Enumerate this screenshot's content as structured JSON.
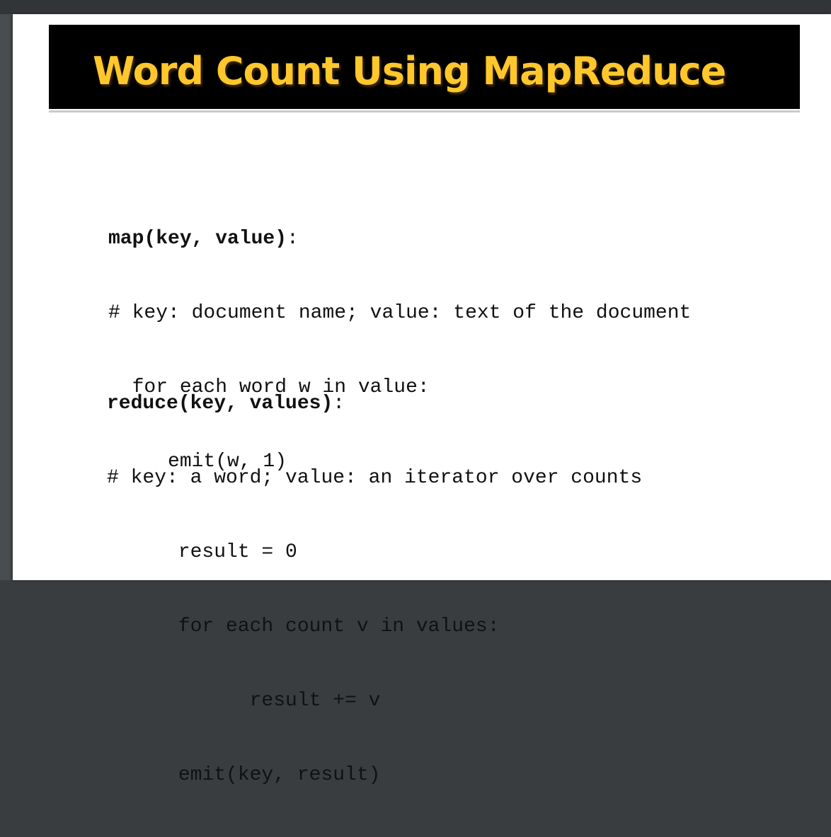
{
  "slide": {
    "title": "Word Count Using MapReduce",
    "map_block": {
      "signature": "map(key, value)",
      "sig_colon": ":",
      "lines": [
        "# key: document name; value: text of the document",
        "  for each word w in value:",
        "     emit(w, 1)"
      ]
    },
    "reduce_block": {
      "signature": "reduce(key, values)",
      "sig_colon": ":",
      "lines": [
        "# key: a word; value: an iterator over counts",
        "      result = 0",
        "      for each count v in values:",
        "            result += v",
        "      emit(key, result)"
      ]
    },
    "colors": {
      "title_text": "#ffc72c",
      "title_band": "#000000",
      "code_text": "#111111"
    }
  }
}
